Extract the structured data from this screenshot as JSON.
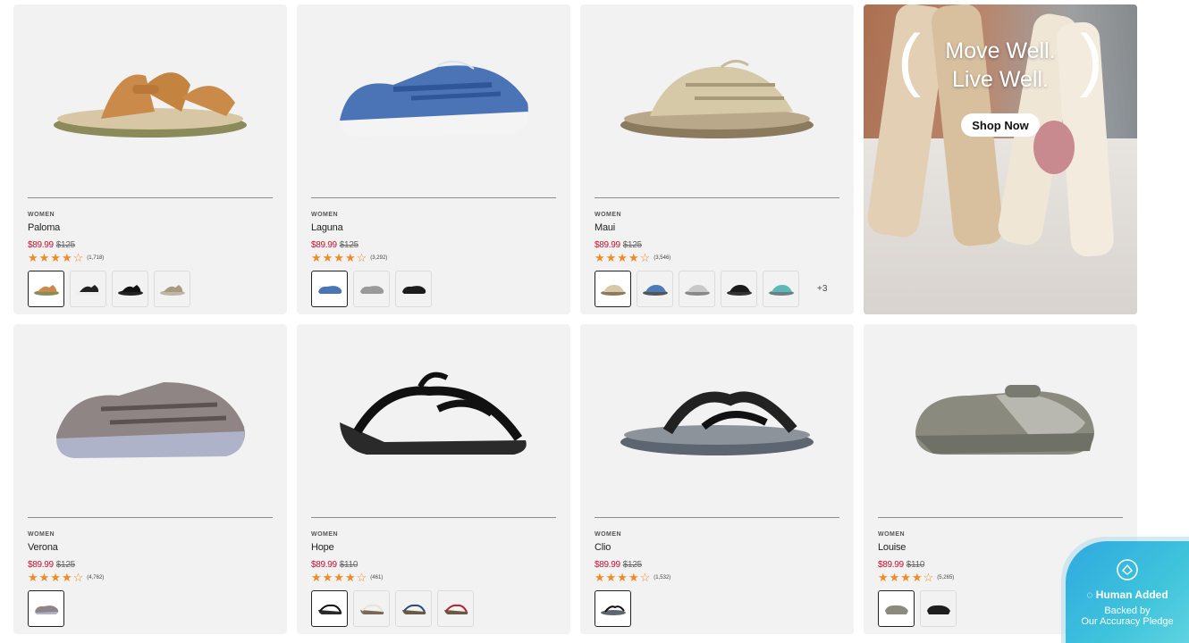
{
  "products": [
    {
      "category": "WOMEN",
      "name": "Paloma",
      "sale_price": "$89.99",
      "original_price": "$125",
      "rating": 3.5,
      "stars": "★★★★☆",
      "review_count": "(1,718)",
      "swatches": [
        "tan",
        "black-white",
        "black",
        "taupe"
      ],
      "extra_swatches": ""
    },
    {
      "category": "WOMEN",
      "name": "Laguna",
      "sale_price": "$89.99",
      "original_price": "$125",
      "rating": 3.5,
      "stars": "★★★★☆",
      "review_count": "(3,292)",
      "swatches": [
        "blue",
        "grey",
        "black"
      ],
      "extra_swatches": ""
    },
    {
      "category": "WOMEN",
      "name": "Maui",
      "sale_price": "$89.99",
      "original_price": "$125",
      "rating": 3.5,
      "stars": "★★★★☆",
      "review_count": "(3,546)",
      "swatches": [
        "beige",
        "blue",
        "light-grey",
        "black",
        "teal"
      ],
      "extra_swatches": "+3"
    },
    {
      "category": "WOMEN",
      "name": "Verona",
      "sale_price": "$89.99",
      "original_price": "$125",
      "rating": 3.5,
      "stars": "★★★★☆",
      "review_count": "(4,762)",
      "swatches": [
        "pewter"
      ],
      "extra_swatches": ""
    },
    {
      "category": "WOMEN",
      "name": "Hope",
      "sale_price": "$89.99",
      "original_price": "$110",
      "rating": 3.5,
      "stars": "★★★★☆",
      "review_count": "(461)",
      "swatches": [
        "black",
        "white",
        "navy",
        "red"
      ],
      "extra_swatches": ""
    },
    {
      "category": "WOMEN",
      "name": "Clio",
      "sale_price": "$89.99",
      "original_price": "$125",
      "rating": 3.5,
      "stars": "★★★★☆",
      "review_count": "(1,532)",
      "swatches": [
        "black"
      ],
      "extra_swatches": ""
    },
    {
      "category": "WOMEN",
      "name": "Louise",
      "sale_price": "$89.99",
      "original_price": "$110",
      "rating": 3.5,
      "stars": "★★★★☆",
      "review_count": "(5,265)",
      "swatches": [
        "grey",
        "black"
      ],
      "extra_swatches": ""
    }
  ],
  "promo": {
    "line1": "Move Well.",
    "line2": "Live Well.",
    "cta": "Shop Now"
  },
  "badge": {
    "title": "Human Added",
    "line1": "Backed by",
    "line2": "Our Accuracy Pledge",
    "icon": "shield-check-icon"
  },
  "colors": {
    "sale": "#c8102e",
    "star": "#f08a24",
    "badge": "#3ec3dc",
    "card_bg": "#f2f2f2"
  }
}
